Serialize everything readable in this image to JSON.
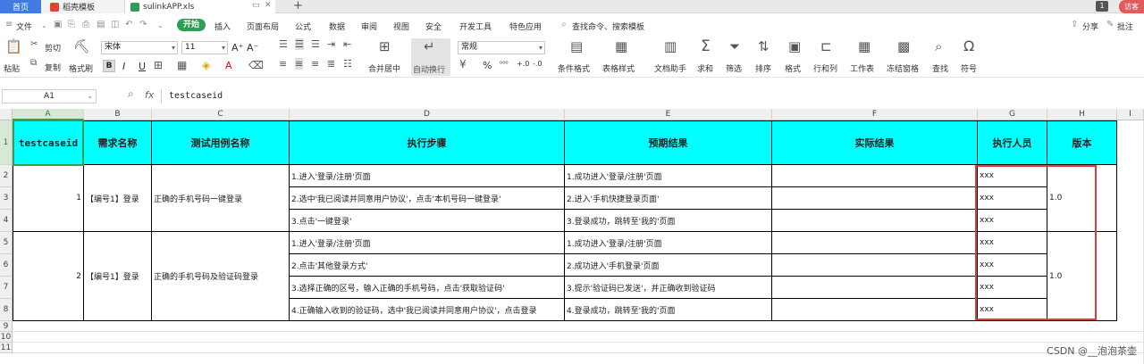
{
  "tabs": {
    "home": "首页",
    "template": "稻壳模板",
    "file": "sulinkAPP.xls",
    "new_tab": "+",
    "count_badge": "1",
    "visitor": "访客"
  },
  "menu": {
    "file": "文件",
    "start": "开始",
    "items": [
      "插入",
      "页面布局",
      "公式",
      "数据",
      "审阅",
      "视图",
      "安全",
      "开发工具",
      "特色应用"
    ],
    "search": "查找命令、搜索模板",
    "share": "分享",
    "comment": "批注"
  },
  "ribbon": {
    "paste": "粘贴",
    "cut": "剪切",
    "copy": "复制",
    "format_painter": "格式刷",
    "font_name": "宋体",
    "font_size": "11",
    "bold": "B",
    "italic": "I",
    "underline": "U",
    "merge_center": "合并居中",
    "auto_wrap": "自动换行",
    "number_format": "常规",
    "percent": "%",
    "conditional_format": "条件格式",
    "table_style": "表格样式",
    "doc_helper": "文档助手",
    "sum": "求和",
    "filter": "筛选",
    "sort": "排序",
    "format": "格式",
    "row_col": "行和列",
    "worksheet": "工作表",
    "freeze": "冻结窗格",
    "find": "查找",
    "symbol": "符号"
  },
  "formula_bar": {
    "cell_ref": "A1",
    "fx": "fx",
    "content": "testcaseid"
  },
  "columns": [
    "A",
    "B",
    "C",
    "D",
    "E",
    "F",
    "G",
    "H",
    "I"
  ],
  "rows": [
    "1",
    "2",
    "3",
    "4",
    "5",
    "6",
    "7",
    "8",
    "9",
    "10",
    "11"
  ],
  "sheet": {
    "headers": [
      "testcaseid",
      "需求名称",
      "测试用例名称",
      "执行步骤",
      "预期结果",
      "实际结果",
      "执行人员",
      "版本"
    ],
    "case1": {
      "id": "1",
      "requirement": "【编号1】登录",
      "name": "正确的手机号码一键登录",
      "steps": [
        "1.进入'登录/注册'页面",
        "2.选中'我已阅读并同意用户协议'，点击'本机号码一键登录'",
        "3.点击'一键登录'"
      ],
      "expected": [
        "1.成功进入'登录/注册'页面",
        "2.进入'手机快捷登录页面'",
        "3.登录成功，跳转至'我的'页面"
      ],
      "executor": [
        "xxx",
        "xxx",
        "xxx"
      ],
      "version": "1.0"
    },
    "case2": {
      "id": "2",
      "requirement": "【编号1】登录",
      "name": "正确的手机号码及验证码登录",
      "steps": [
        "1.进入'登录/注册'页面",
        "2.点击'其他登录方式'",
        "3.选择正确的区号，输入正确的手机号码，点击'获取验证码'",
        "4.正确输入收到的验证码，选中'我已阅读并同意用户协议'，点击登录"
      ],
      "expected": [
        "1.成功进入'登录/注册'页面",
        "2.成功进入'手机登录'页面",
        "3.提示'验证码已发送'，并正确收到验证码",
        "4.登录成功，跳转至'我的'页面"
      ],
      "executor": [
        "xxx",
        "xxx",
        "xxx",
        "xxx"
      ],
      "version": "1.0"
    }
  },
  "watermark": "CSDN @__泡泡茶壶",
  "colors": {
    "header_fill": "#00ffff",
    "accent": "#2f9e55",
    "highlight_box": "#e23b3b"
  }
}
